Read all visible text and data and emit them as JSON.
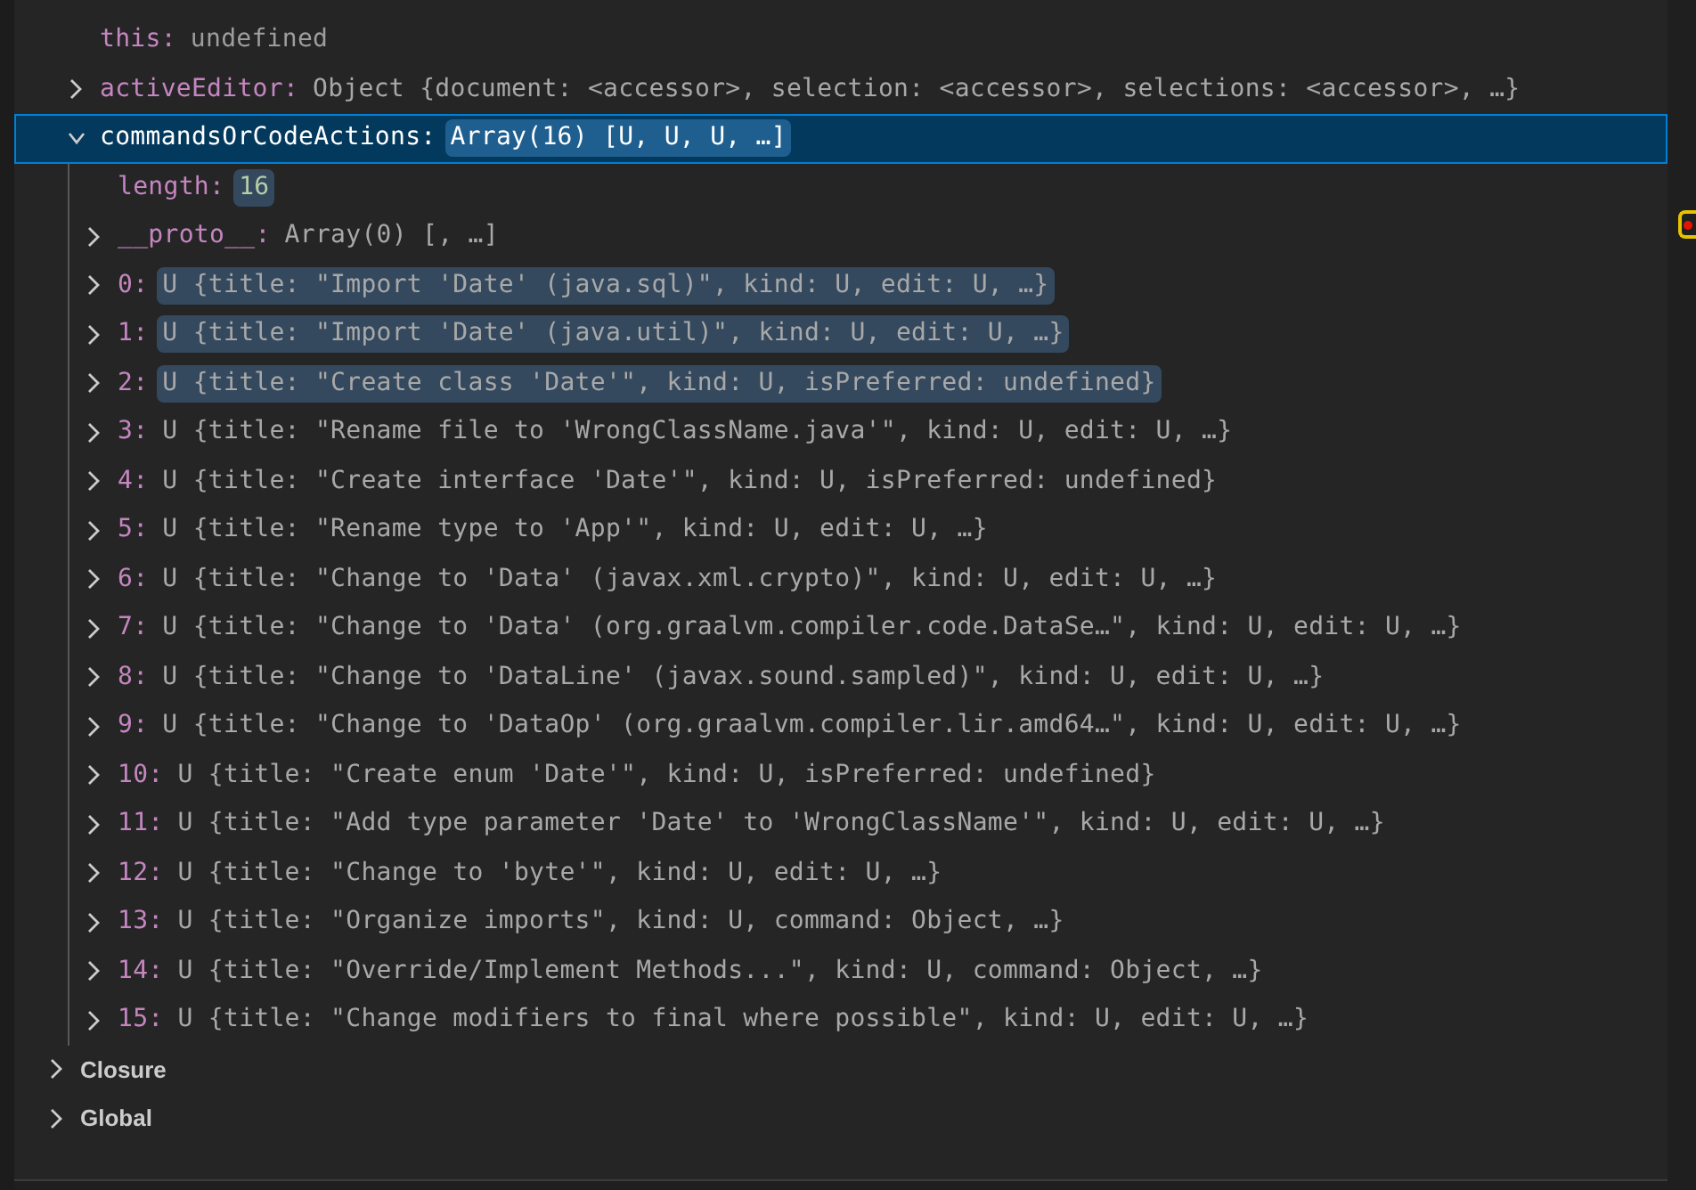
{
  "variables": [
    {
      "name": "this:",
      "value": "undefined",
      "kind": "undefined",
      "selected": false,
      "highlighted": false
    },
    {
      "name": "activeEditor:",
      "value": "Object {document: <accessor>, selection: <accessor>, selections: <accessor>, …}",
      "kind": "object",
      "expanded": false,
      "selected": false,
      "highlighted": false
    },
    {
      "name": "commandsOrCodeActions:",
      "value": "Array(16) [U, U, U, …]",
      "expanded": true,
      "selected": true,
      "highlighted": true,
      "children": [
        {
          "name": "length:",
          "value": "16",
          "kind": "number",
          "selected": false,
          "highlighted": true
        },
        {
          "name": "__proto__:",
          "value": "Array(0) [, …]",
          "kind": "object",
          "expanded": false,
          "selected": false,
          "highlighted": false
        },
        {
          "name": "0:",
          "value": "U {title: \"Import 'Date' (java.sql)\", kind: U, edit: U, …}",
          "kind": "object",
          "expanded": false,
          "selected": false,
          "highlighted": true
        },
        {
          "name": "1:",
          "value": "U {title: \"Import 'Date' (java.util)\", kind: U, edit: U, …}",
          "kind": "object",
          "expanded": false,
          "selected": false,
          "highlighted": true
        },
        {
          "name": "2:",
          "value": "U {title: \"Create class 'Date'\", kind: U, isPreferred: undefined}",
          "kind": "object",
          "expanded": false,
          "selected": false,
          "highlighted": true
        },
        {
          "name": "3:",
          "value": "U {title: \"Rename file to 'WrongClassName.java'\", kind: U, edit: U, …}",
          "kind": "object",
          "expanded": false,
          "selected": false,
          "highlighted": false
        },
        {
          "name": "4:",
          "value": "U {title: \"Create interface 'Date'\", kind: U, isPreferred: undefined}",
          "kind": "object",
          "expanded": false,
          "selected": false,
          "highlighted": false
        },
        {
          "name": "5:",
          "value": "U {title: \"Rename type to 'App'\", kind: U, edit: U, …}",
          "kind": "object",
          "expanded": false,
          "selected": false,
          "highlighted": false
        },
        {
          "name": "6:",
          "value": "U {title: \"Change to 'Data' (javax.xml.crypto)\", kind: U, edit: U, …}",
          "kind": "object",
          "expanded": false,
          "selected": false,
          "highlighted": false
        },
        {
          "name": "7:",
          "value": "U {title: \"Change to 'Data' (org.graalvm.compiler.code.DataSe…\", kind: U, edit: U, …}",
          "kind": "object",
          "expanded": false,
          "selected": false,
          "highlighted": false
        },
        {
          "name": "8:",
          "value": "U {title: \"Change to 'DataLine' (javax.sound.sampled)\", kind: U, edit: U, …}",
          "kind": "object",
          "expanded": false,
          "selected": false,
          "highlighted": false
        },
        {
          "name": "9:",
          "value": "U {title: \"Change to 'DataOp' (org.graalvm.compiler.lir.amd64…\", kind: U, edit: U, …}",
          "kind": "object",
          "expanded": false,
          "selected": false,
          "highlighted": false
        },
        {
          "name": "10:",
          "value": "U {title: \"Create enum 'Date'\", kind: U, isPreferred: undefined}",
          "kind": "object",
          "expanded": false,
          "selected": false,
          "highlighted": false
        },
        {
          "name": "11:",
          "value": "U {title: \"Add type parameter 'Date' to 'WrongClassName'\", kind: U, edit: U, …}",
          "kind": "object",
          "expanded": false,
          "selected": false,
          "highlighted": false
        },
        {
          "name": "12:",
          "value": "U {title: \"Change to 'byte'\", kind: U, edit: U, …}",
          "kind": "object",
          "expanded": false,
          "selected": false,
          "highlighted": false
        },
        {
          "name": "13:",
          "value": "U {title: \"Organize imports\", kind: U, command: Object, …}",
          "kind": "object",
          "expanded": false,
          "selected": false,
          "highlighted": false
        },
        {
          "name": "14:",
          "value": "U {title: \"Override/Implement Methods...\", kind: U, command: Object, …}",
          "kind": "object",
          "expanded": false,
          "selected": false,
          "highlighted": false
        },
        {
          "name": "15:",
          "value": "U {title: \"Change modifiers to final where possible\", kind: U, edit: U, …}",
          "kind": "object",
          "expanded": false,
          "selected": false,
          "highlighted": false
        }
      ]
    }
  ],
  "scopes": [
    {
      "name": "Closure",
      "expanded": false
    },
    {
      "name": "Global",
      "expanded": false
    }
  ]
}
